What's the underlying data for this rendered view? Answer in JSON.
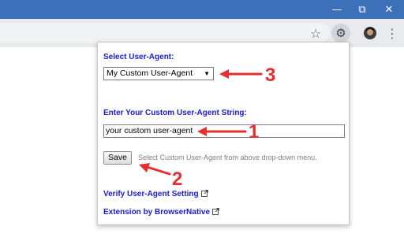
{
  "popup": {
    "select_label": "Select User-Agent:",
    "selected_agent": "My Custom User-Agent",
    "custom_label": "Enter Your Custom User-Agent String:",
    "custom_value": "your custom user-agent",
    "save_label": "Save",
    "hint": "Select Custom User-Agent from above drop-down menu.",
    "verify_link": "Verify User-Agent Setting",
    "extension_link": "Extension by BrowserNative"
  },
  "annotations": {
    "one": "1",
    "two": "2",
    "three": "3",
    "color": "#e62e2e"
  },
  "icons": [
    "minimize-icon",
    "restore-icon",
    "close-icon",
    "star-icon",
    "gear-icon",
    "avatar",
    "kebab-menu-icon",
    "external-link-icon",
    "dropdown-caret-icon"
  ],
  "colors": {
    "titlebar": "#3c70b8",
    "link_blue": "#1a1ad6"
  }
}
